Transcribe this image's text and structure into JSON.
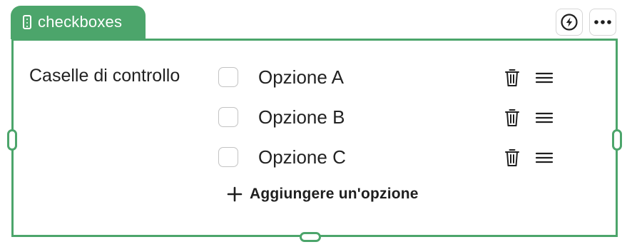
{
  "block": {
    "type_label": "checkboxes",
    "type_icon": "vertical-dots-icon",
    "accent_color": "#4ca56b"
  },
  "toolbar": {
    "actions_icon": "lightning-circle-icon",
    "more_icon": "more-horizontal-icon"
  },
  "field": {
    "label": "Caselle di controllo",
    "options": [
      {
        "label": "Opzione A",
        "checked": false
      },
      {
        "label": "Opzione B",
        "checked": false
      },
      {
        "label": "Opzione C",
        "checked": false
      }
    ],
    "add_option_label": "Aggiungere un'opzione"
  }
}
